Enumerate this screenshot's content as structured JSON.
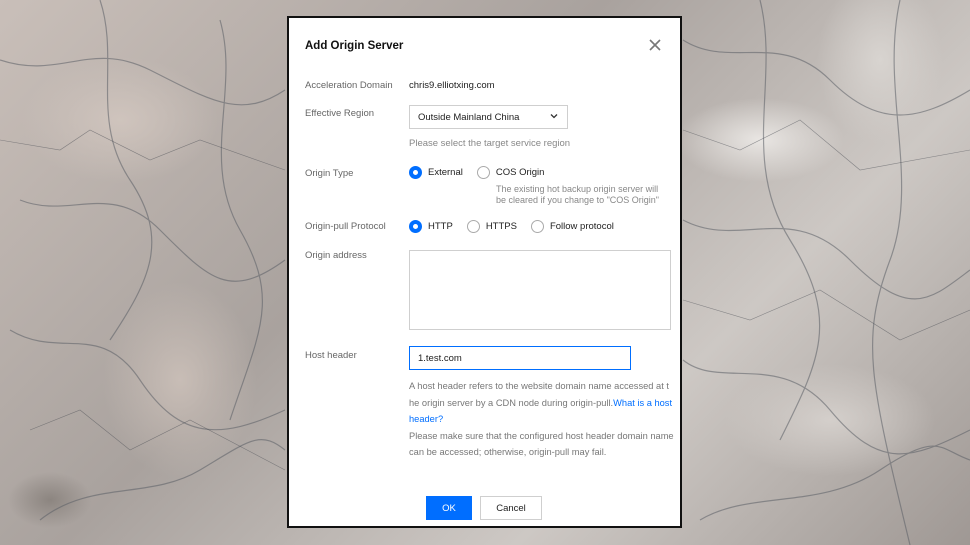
{
  "dialog": {
    "title": "Add Origin Server",
    "fields": {
      "acceleration_domain": {
        "label": "Acceleration Domain",
        "value": "chris9.elliotxing.com"
      },
      "effective_region": {
        "label": "Effective Region",
        "selected": "Outside Mainland China",
        "hint": "Please select the target service region"
      },
      "origin_type": {
        "label": "Origin Type",
        "options": [
          "External",
          "COS Origin"
        ],
        "selected": "External",
        "hint_line1": "The existing hot backup origin server will",
        "hint_line2": "be cleared if you change to \"COS Origin\""
      },
      "origin_pull_protocol": {
        "label": "Origin-pull Protocol",
        "options": [
          "HTTP",
          "HTTPS",
          "Follow protocol"
        ],
        "selected": "HTTP"
      },
      "origin_address": {
        "label": "Origin address",
        "value": ""
      },
      "host_header": {
        "label": "Host header",
        "value": "1.test.com",
        "desc_part1": "A host header refers to the website domain name accessed at the origin server by a CDN node during origin-pull.",
        "desc_link": "What is a host header?",
        "desc_part2": "Please make sure that the configured host header domain name can be accessed; otherwise, origin-pull may fail."
      }
    },
    "buttons": {
      "ok": "OK",
      "cancel": "Cancel"
    }
  },
  "colors": {
    "accent": "#006eff",
    "border": "#cfcfcf"
  },
  "icons": {
    "close": "close-icon",
    "dropdown": "chevron-down-icon"
  }
}
